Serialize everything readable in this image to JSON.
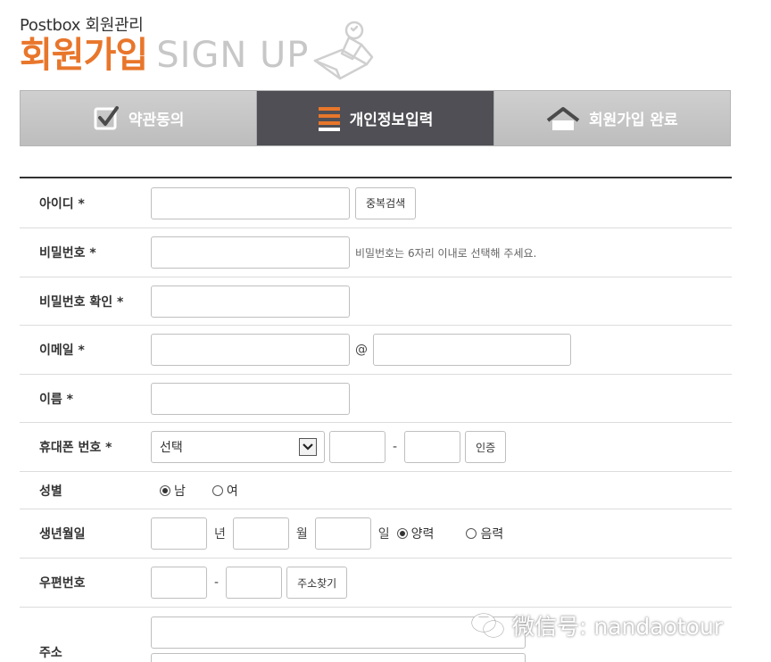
{
  "header": {
    "brand_small": "Postbox 회원관리",
    "title_ko": "회원가입",
    "title_en": "SIGN UP"
  },
  "steps": [
    {
      "label": "약관동의",
      "icon": "checkbox-icon",
      "active": false
    },
    {
      "label": "개인정보입력",
      "icon": "list-icon",
      "active": true
    },
    {
      "label": "회원가입 완료",
      "icon": "house-icon",
      "active": false
    }
  ],
  "form": {
    "id_label": "아이디 *",
    "id_check_button": "중복검색",
    "password_label": "비밀번호 *",
    "password_hint": "비밀번호는 6자리 이내로 선택해 주세요.",
    "password_confirm_label": "비밀번호 확인 *",
    "email_label": "이메일 *",
    "email_at": "@",
    "name_label": "이름 *",
    "phone_label": "휴대폰 번호 *",
    "phone_select_value": "선택",
    "phone_dash": "-",
    "phone_verify_button": "인증",
    "gender_label": "성별",
    "gender_male": "남",
    "gender_female": "여",
    "birth_label": "생년월일",
    "birth_year_unit": "년",
    "birth_month_unit": "월",
    "birth_day_unit": "일",
    "calendar_solar": "양력",
    "calendar_lunar": "음력",
    "zip_label": "우편번호",
    "zip_dash": "-",
    "zip_search_button": "주소찾기",
    "address_label": "주소"
  },
  "watermark": {
    "text": "微信号: nandaotour"
  },
  "colors": {
    "brand_orange": "#e8762b",
    "active_step": "#4f4f55",
    "inactive_step": "#c4c4c4"
  }
}
